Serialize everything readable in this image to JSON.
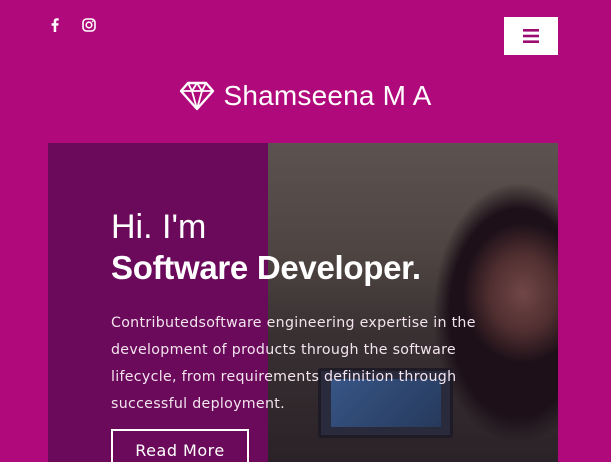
{
  "header": {
    "social_icons": [
      "facebook-icon",
      "instagram-icon"
    ],
    "menu_icon": "hamburger-menu-icon",
    "brand_name": "Shamseena M A",
    "brand_icon": "diamond-icon"
  },
  "hero": {
    "greeting": "Hi. I'm",
    "title": "Software Developer.",
    "description": "Contributedsoftware engineering expertise in the development of products through the software lifecycle, from requirements definition through successful deployment.",
    "cta_label": "Read More"
  },
  "colors": {
    "page_background": "#b0097b",
    "hero_panel": "#6b0a5b",
    "text": "#ffffff"
  }
}
